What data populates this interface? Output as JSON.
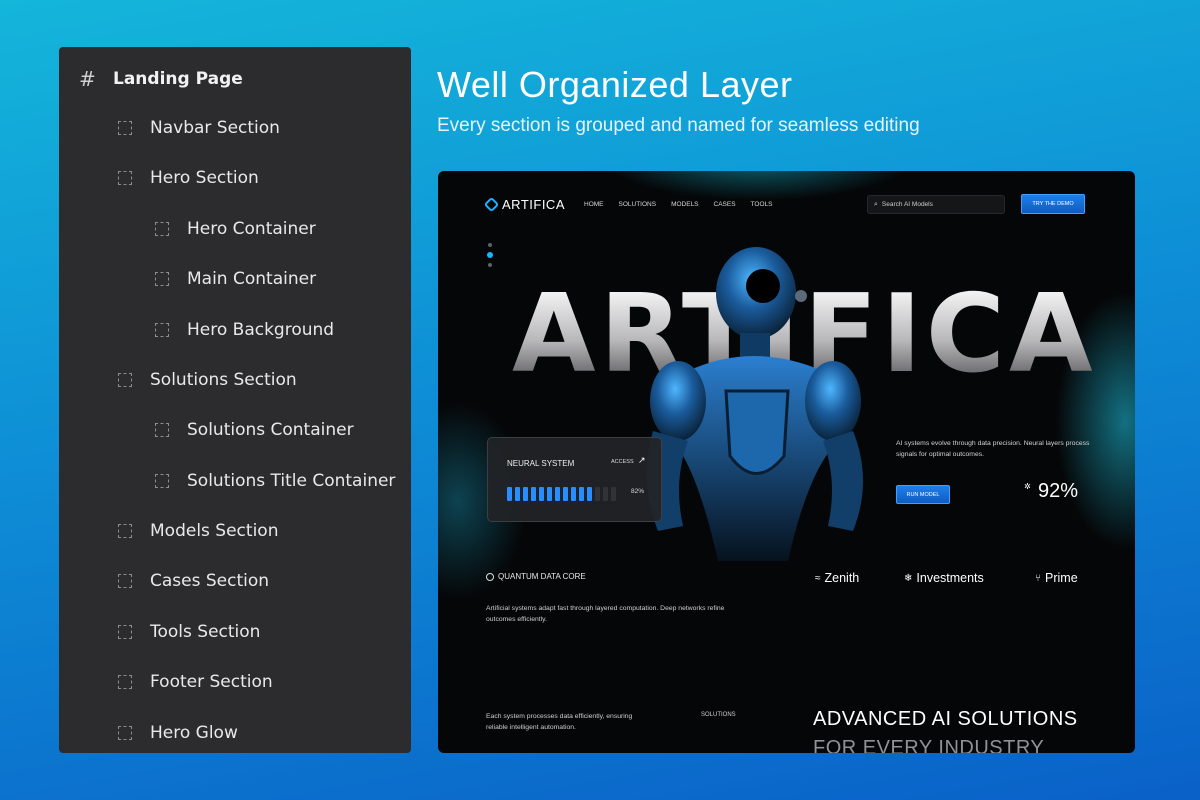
{
  "layers": {
    "root_label": "Landing Page",
    "items": [
      {
        "label": "Navbar Section"
      },
      {
        "label": "Hero Section"
      },
      {
        "label": "Hero Container"
      },
      {
        "label": "Main Container"
      },
      {
        "label": "Hero Background"
      },
      {
        "label": "Solutions Section"
      },
      {
        "label": "Solutions Container"
      },
      {
        "label": "Solutions Title Container"
      },
      {
        "label": "Models Section"
      },
      {
        "label": "Cases Section"
      },
      {
        "label": "Tools Section"
      },
      {
        "label": "Footer Section"
      },
      {
        "label": "Hero Glow"
      }
    ]
  },
  "header": {
    "title": "Well Organized Layer",
    "subtitle": "Every section is grouped and named for seamless editing"
  },
  "preview": {
    "logo": "ARTIFICA",
    "nav": [
      "HOME",
      "SOLUTIONS",
      "MODELS",
      "CASES",
      "TOOLS"
    ],
    "search_placeholder": "Search AI Models",
    "demo_button": "TRY THE DEMO",
    "hero_word": "ARTIFICA",
    "neural_card": {
      "title": "NEURAL SYSTEM",
      "access": "ACCESS",
      "percent": "82%",
      "level": 0.82
    },
    "description": "AI systems evolve through data precision. Neural layers process signals for optimal outcomes.",
    "run_button": "RUN MODEL",
    "stat_value": "92%",
    "quantum_label": "QUANTUM DATA CORE",
    "brands": [
      "Zenith",
      "Investments",
      "Prime"
    ],
    "paragraph1": "Artificial systems adapt fast through layered computation. Deep networks refine outcomes efficiently.",
    "paragraph2": "Each system processes data efficiently, ensuring reliable intelligent automation.",
    "solutions_label": "SOLUTIONS",
    "advanced_line1": "ADVANCED AI SOLUTIONS",
    "advanced_line2": "FOR EVERY INDUSTRY"
  },
  "colors": {
    "accent": "#1ab4ff",
    "button": "#1f7fe8",
    "panel": "#2c2c2e",
    "background_top": "#14b6da",
    "background_bottom": "#0a61c8"
  }
}
